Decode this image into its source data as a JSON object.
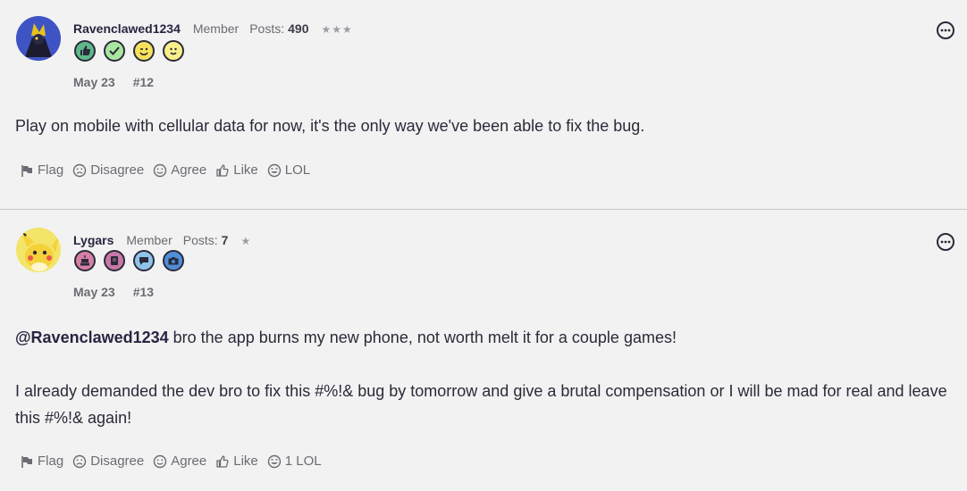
{
  "posts": [
    {
      "username": "Ravenclawed1234",
      "role": "Member",
      "posts_label": "Posts:",
      "posts_count": "490",
      "stars": "★★★",
      "badges": [
        "thumbs-up-badge-icon",
        "check-badge-icon",
        "wink-badge-icon",
        "smile-badge-icon"
      ],
      "date": "May 23",
      "post_number": "#12",
      "body": {
        "text": "Play on mobile with cellular data for now, it's the only way we've been able to fix the bug."
      },
      "actions": {
        "flag": "Flag",
        "disagree": "Disagree",
        "agree": "Agree",
        "like": "Like",
        "lol": "LOL"
      }
    },
    {
      "username": "Lygars",
      "role": "Member",
      "posts_label": "Posts:",
      "posts_count": "7",
      "stars": "★",
      "badges": [
        "cake-badge-icon",
        "notebook-badge-icon",
        "speech-bubble-badge-icon",
        "camera-badge-icon"
      ],
      "date": "May 23",
      "post_number": "#13",
      "body": {
        "mention": "@Ravenclawed1234",
        "line1": " bro the app burns my new phone, not worth melt it for a couple games!",
        "line2": "I already demanded the dev bro to fix this  #%!& bug by tomorrow and give a brutal compensation or I will be mad for real and leave this  #%!& again!"
      },
      "actions": {
        "flag": "Flag",
        "disagree": "Disagree",
        "agree": "Agree",
        "like": "Like",
        "lol": "1 LOL"
      }
    }
  ]
}
